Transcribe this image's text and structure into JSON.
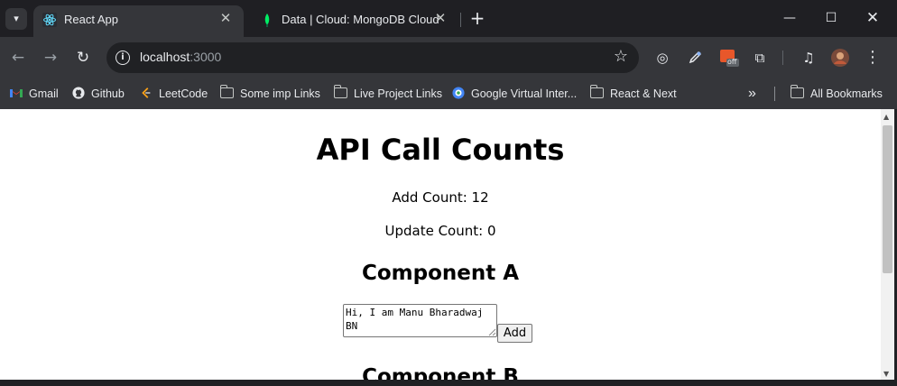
{
  "browser": {
    "tabs": [
      {
        "title": "React App",
        "favicon": "react-icon",
        "active": true
      },
      {
        "title": "Data | Cloud: MongoDB Cloud",
        "favicon": "mongodb-leaf-icon",
        "active": false
      }
    ],
    "url_host": "localhost",
    "url_port": ":3000",
    "bookmarks": [
      {
        "label": "Gmail",
        "icon": "gmail-icon"
      },
      {
        "label": "Github",
        "icon": "github-icon"
      },
      {
        "label": "LeetCode",
        "icon": "leetcode-icon"
      },
      {
        "label": "Some imp Links",
        "icon": "folder-icon"
      },
      {
        "label": "Live Project Links",
        "icon": "folder-icon"
      },
      {
        "label": "Google Virtual Inter...",
        "icon": "google-icon"
      },
      {
        "label": "React & Next",
        "icon": "folder-icon"
      }
    ],
    "all_bookmarks": "All Bookmarks",
    "overflow": "»",
    "extension_badge": "off"
  },
  "page": {
    "title": "API Call Counts",
    "add_count": "Add Count: 12",
    "update_count": "Update Count: 0",
    "component_a": {
      "heading": "Component A",
      "textarea_value": "Hi, I am Manu Bharadwaj BN",
      "button_label": "Add"
    },
    "component_b": {
      "heading": "Component B"
    }
  },
  "colors": {
    "tab_strip": "#1f1f23",
    "toolbar": "#35363a",
    "omnibox": "#202124",
    "react": "#61dafb",
    "mongodb": "#00ed64"
  }
}
